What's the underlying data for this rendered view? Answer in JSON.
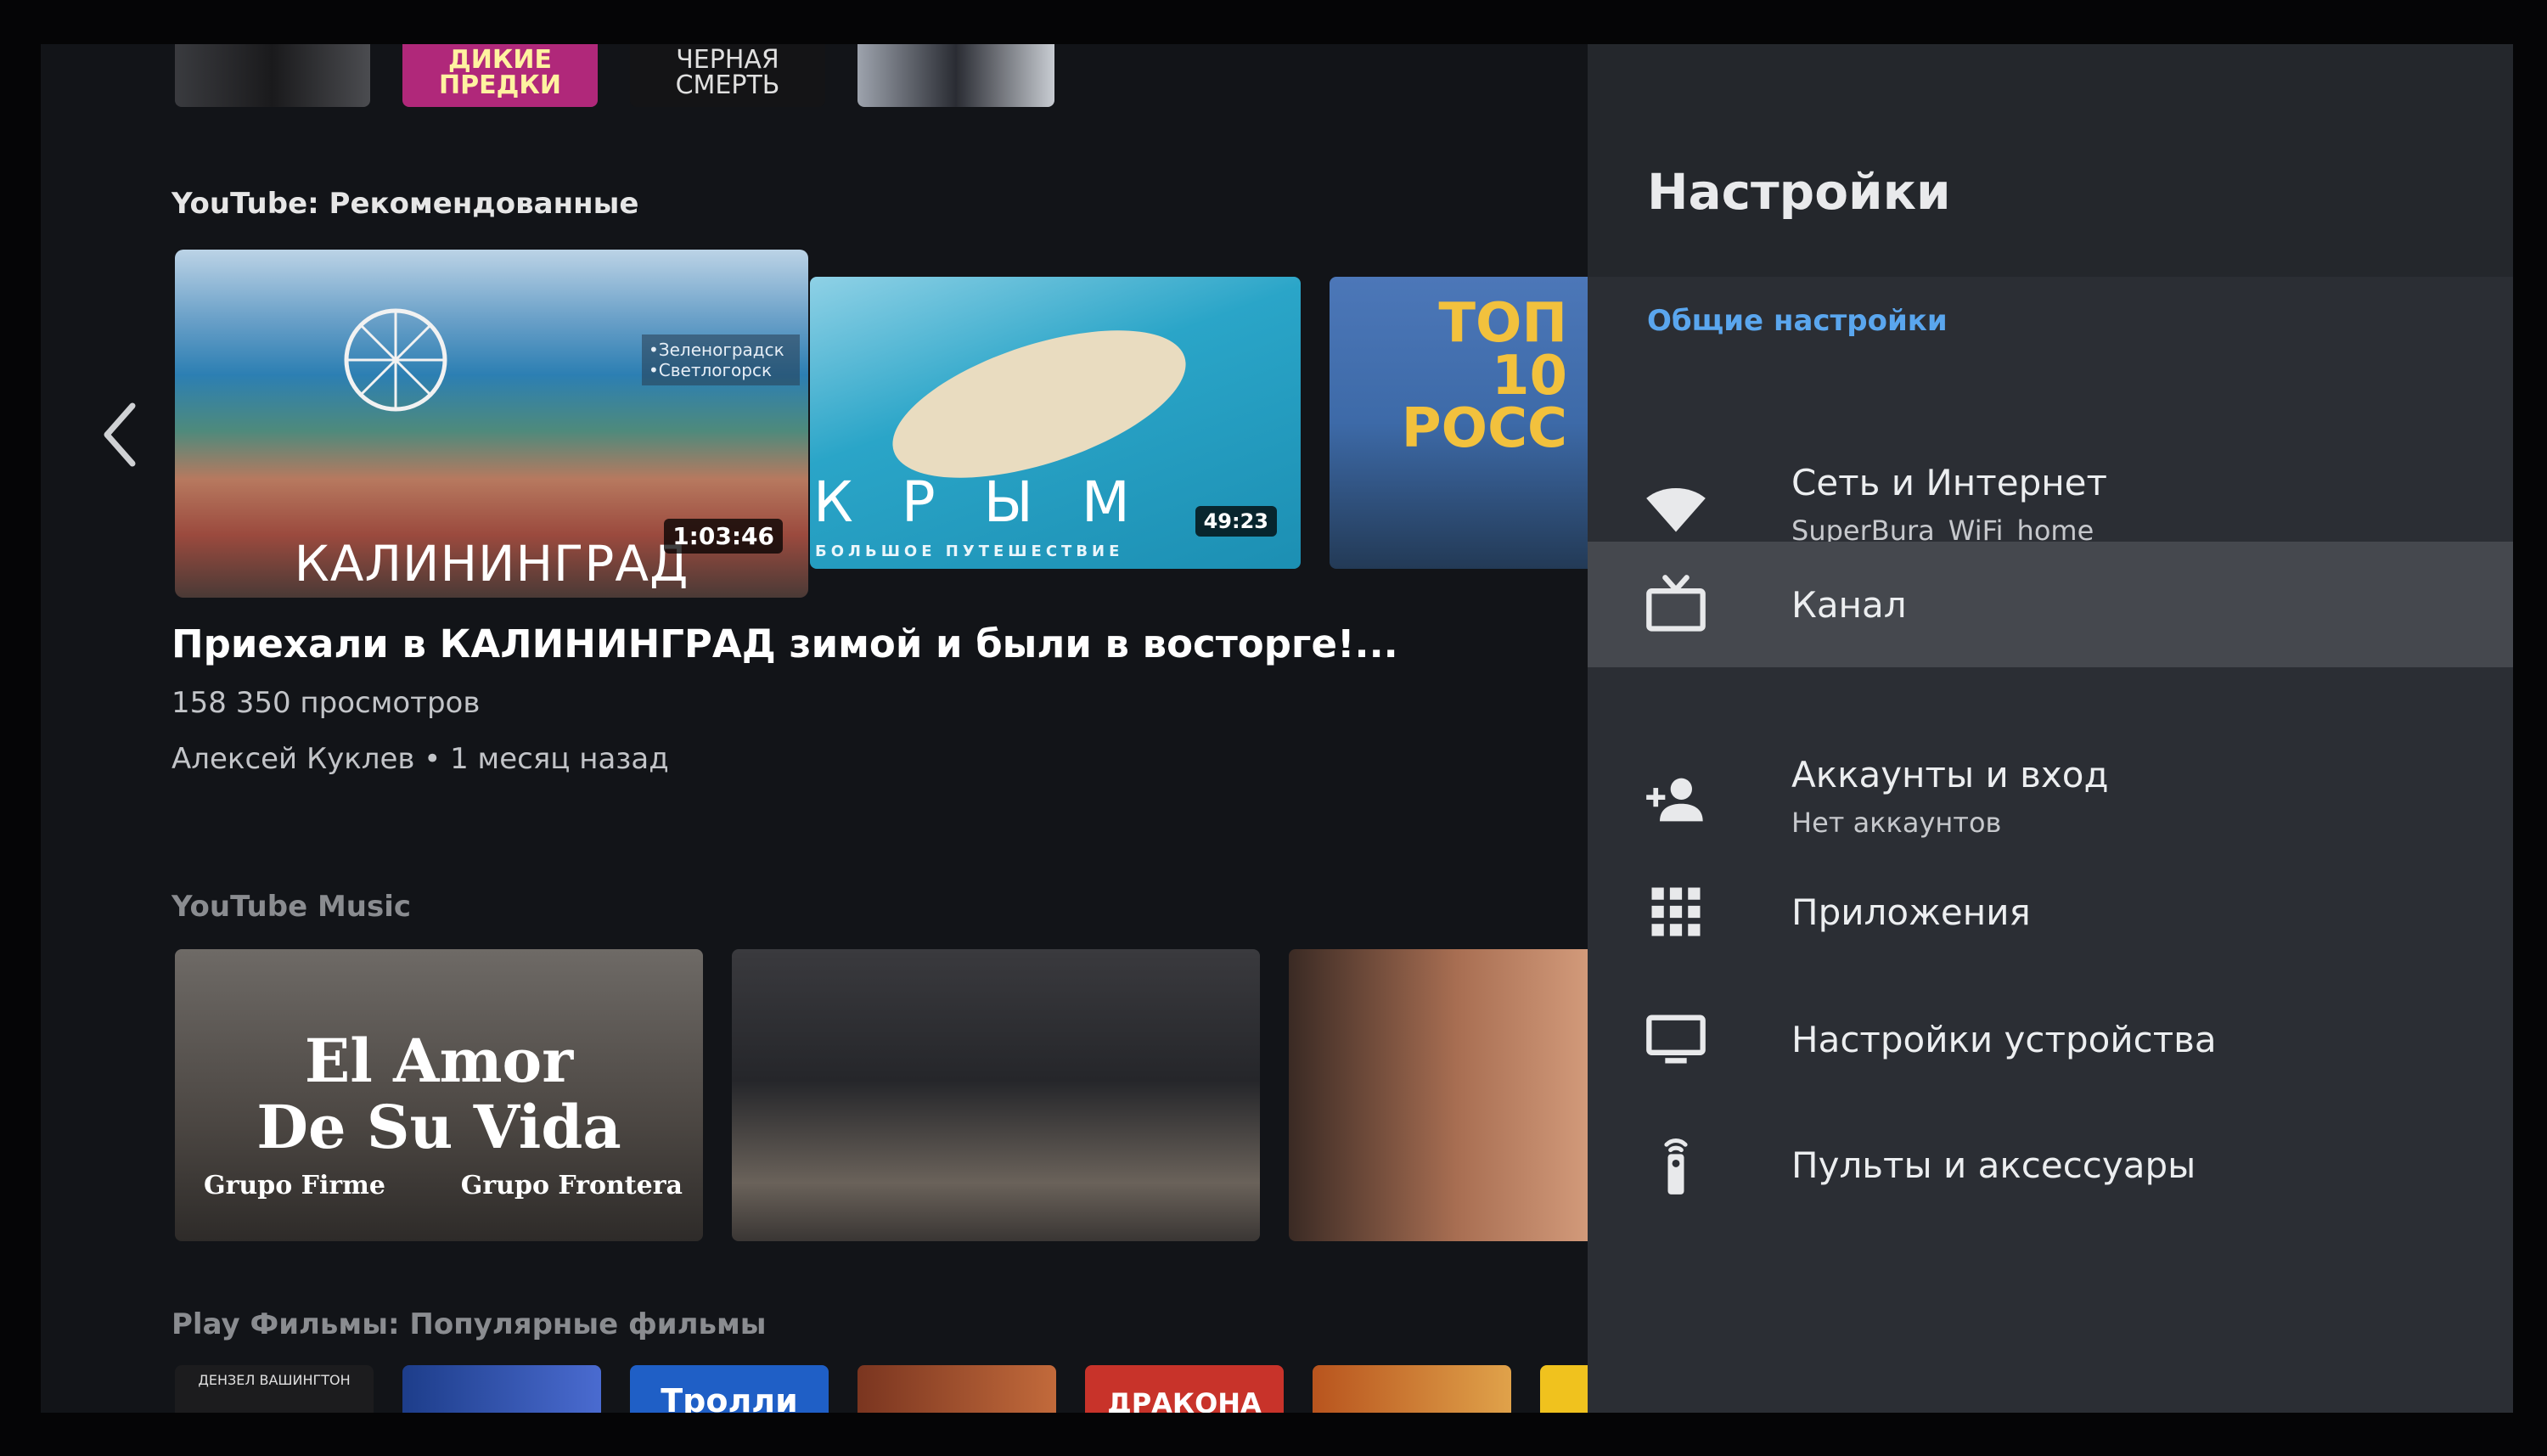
{
  "rows": {
    "recommended_title": "YouTube: Рекомендованные",
    "music_title": "YouTube Music",
    "movies_title": "Play Фильмы: Популярные фильмы"
  },
  "top_strip": [
    "ДИКИЕ ПРЕДКИ",
    "ЧЕРНАЯ СМЕРТЬ"
  ],
  "featured": {
    "thumb_text": "КАЛИНИНГРАД",
    "thumb_caption": "•Зеленоградск •Светлогорск",
    "duration": "1:03:46",
    "title": "Приехали в КАЛИНИНГРАД зимой и были в восторге!...",
    "views": "158 350 просмотров",
    "channel_time": "Алексей Куклев • 1 месяц назад"
  },
  "second_video": {
    "thumb_text": "К Р Ы М",
    "thumb_caption": "БОЛЬШОЕ ПУТЕШЕСТВИЕ",
    "duration": "49:23"
  },
  "third_video": {
    "thumb_text": "ТОП 10 РОСС"
  },
  "music": {
    "card1_line1": "El Amor",
    "card1_line2": "De Su Vida",
    "card1_artist_left": "Grupo Firme",
    "card1_artist_right": "Grupo Frontera"
  },
  "movies_strip": [
    "ДЕНЗЕЛ ВАШИНГТОН",
    "Тролли",
    "ДРАКОНА"
  ],
  "settings": {
    "title": "Настройки",
    "section": "Общие настройки",
    "items": [
      {
        "label": "Сеть и Интернет",
        "sub": "SuperBura_WiFi_home",
        "icon": "wifi-icon"
      },
      {
        "label": "Канал",
        "sub": "",
        "icon": "tv-icon"
      },
      {
        "label": "Аккаунты и вход",
        "sub": "Нет аккаунтов",
        "icon": "add-person-icon"
      },
      {
        "label": "Приложения",
        "sub": "",
        "icon": "apps-grid-icon"
      },
      {
        "label": "Настройки устройства",
        "sub": "",
        "icon": "monitor-icon"
      },
      {
        "label": "Пульты и аксессуары",
        "sub": "",
        "icon": "remote-icon"
      }
    ]
  },
  "colors": {
    "panel": "#2b2e34",
    "selected": "#45484e",
    "accent": "#5aa6ee",
    "background": "#121418"
  }
}
